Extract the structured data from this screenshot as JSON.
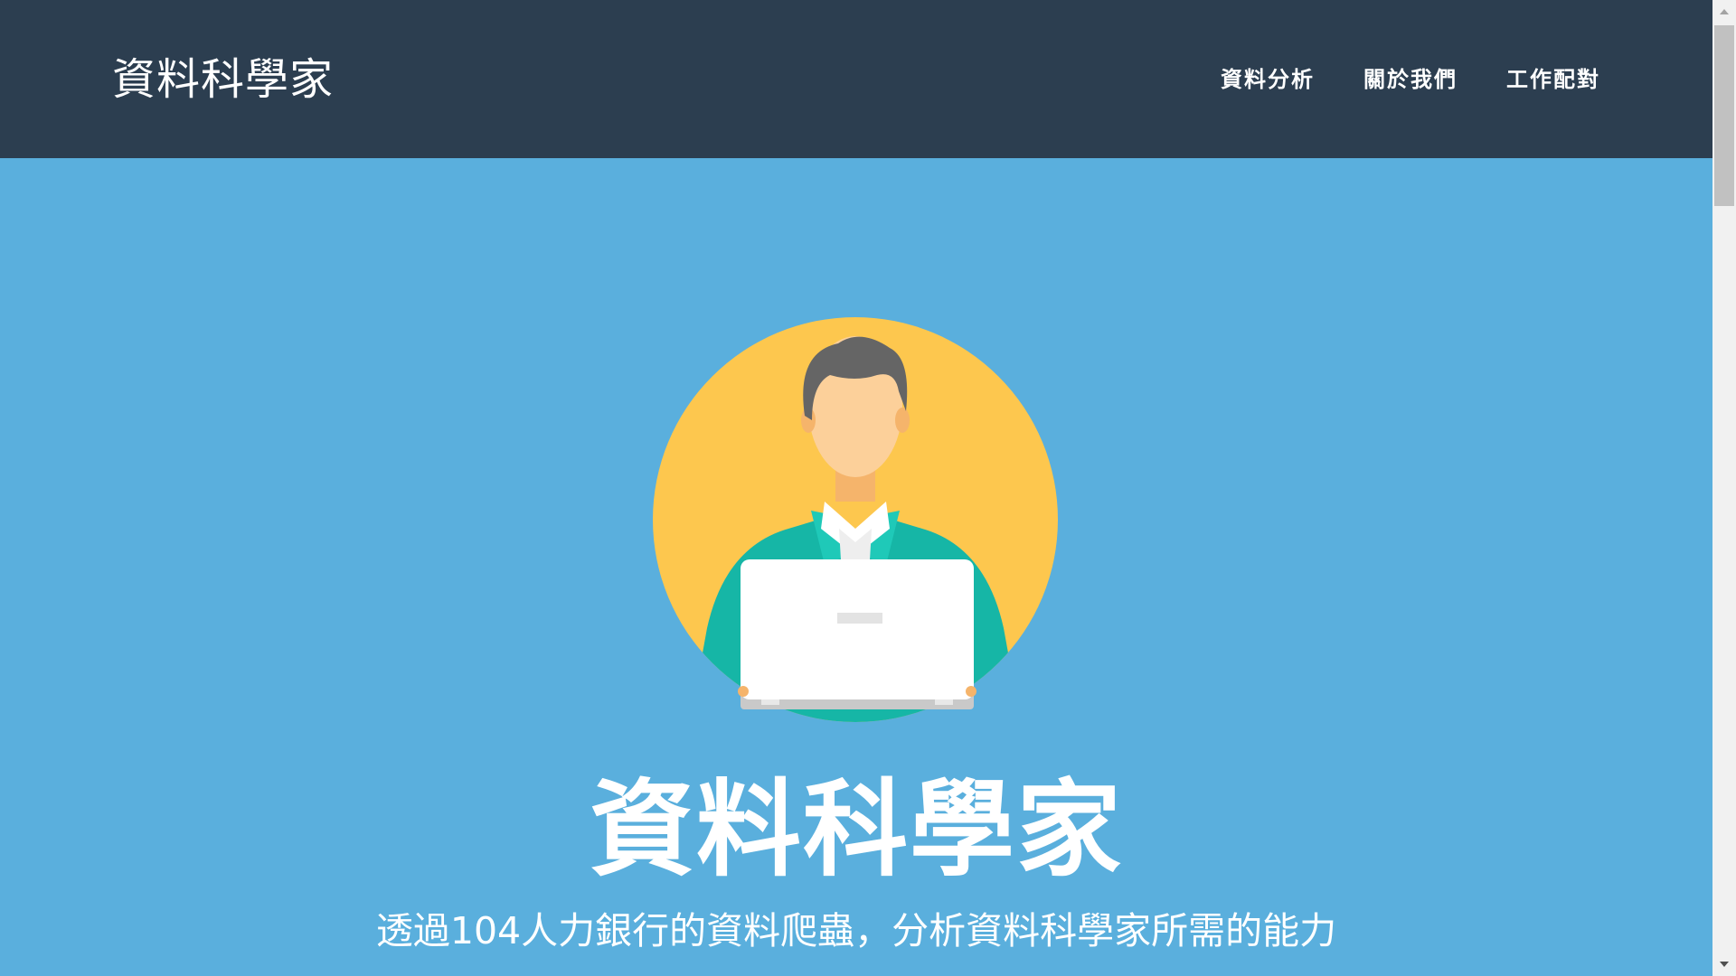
{
  "navbar": {
    "brand": "資料科學家",
    "links": [
      "資料分析",
      "關於我們",
      "工作配對"
    ]
  },
  "hero": {
    "title": "資料科學家",
    "subtitle": "透過104人力銀行的資料爬蟲，分析資料科學家所需的能力",
    "illustration": "data-scientist-avatar"
  },
  "colors": {
    "navbar_bg": "#2c3e50",
    "hero_bg": "#5aafdd",
    "avatar_circle": "#fdc74e",
    "shirt": "#16b6a6",
    "text": "#ffffff"
  }
}
